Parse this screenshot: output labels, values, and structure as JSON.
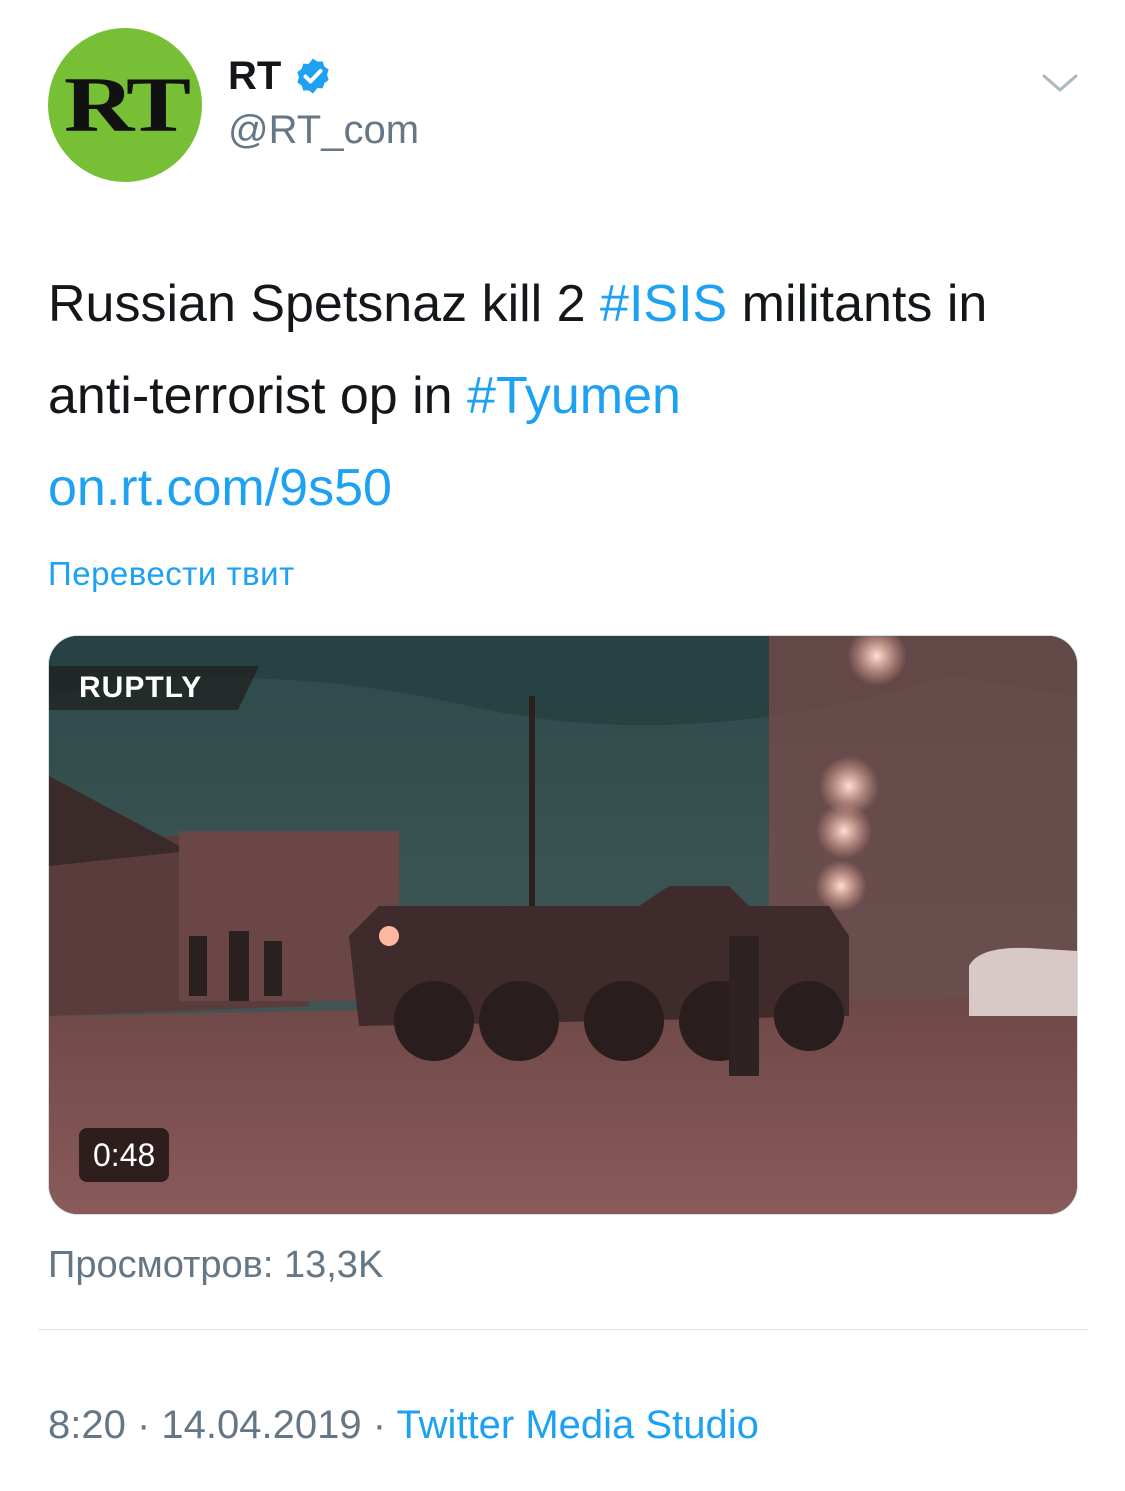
{
  "author": {
    "avatar_text": "RT",
    "display_name": "RT",
    "handle": "@RT_com",
    "verified_icon": "verified-badge-icon",
    "avatar_color": "#77c035"
  },
  "menu_icon": "chevron-down-icon",
  "tweet": {
    "text_part1": "Russian Spetsnaz kill 2 ",
    "hashtag1": "#ISIS",
    "text_part2": " militants in anti-terrorist op in ",
    "hashtag2": "#Tyumen",
    "url": "on.rt.com/9s50",
    "translate_label": "Перевести твит"
  },
  "media": {
    "watermark": "RUPTLY",
    "duration": "0:48"
  },
  "views": "Просмотров: 13,3K",
  "footer": {
    "time": "8:20",
    "separator1": " · ",
    "date": "14.04.2019",
    "separator2": " · ",
    "source": "Twitter Media Studio"
  },
  "colors": {
    "link": "#1da1f2",
    "secondary": "#657786",
    "text": "#14171a"
  }
}
